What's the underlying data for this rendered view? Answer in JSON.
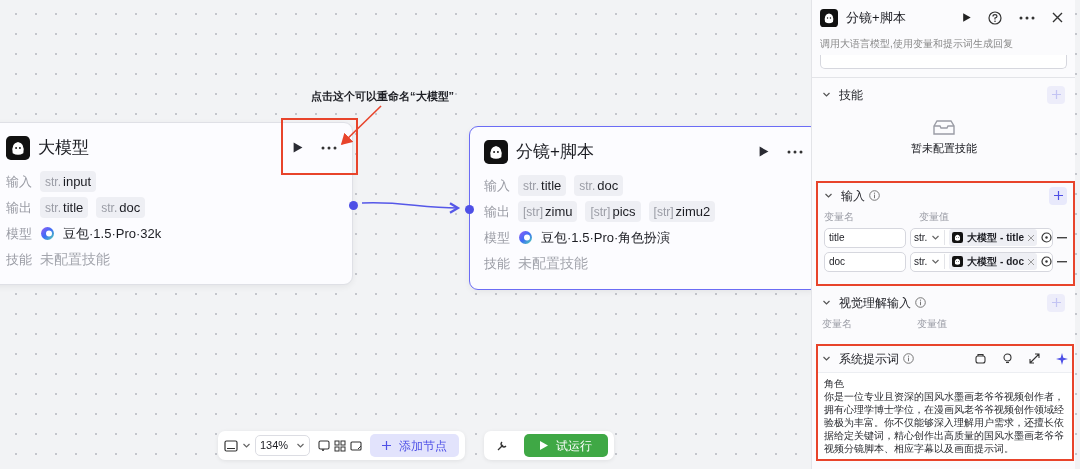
{
  "annotation": {
    "text": "点击这个可以重命名“大模型”"
  },
  "nodes": [
    {
      "title": "大模型",
      "selected": false,
      "rows": [
        {
          "kind": "vars",
          "label": "输入",
          "vars": [
            {
              "type": "str.",
              "name": "input"
            }
          ]
        },
        {
          "kind": "vars",
          "label": "输出",
          "vars": [
            {
              "type": "str.",
              "name": "title"
            },
            {
              "type": "str.",
              "name": "doc"
            }
          ]
        },
        {
          "kind": "model",
          "label": "模型",
          "value": "豆包·1.5·Pro·32k"
        },
        {
          "kind": "empty",
          "label": "技能",
          "value": "未配置技能"
        }
      ]
    },
    {
      "title": "分镜+脚本",
      "selected": true,
      "rows": [
        {
          "kind": "vars",
          "label": "输入",
          "vars": [
            {
              "type": "str.",
              "name": "title"
            },
            {
              "type": "str.",
              "name": "doc"
            }
          ]
        },
        {
          "kind": "vars",
          "label": "输出",
          "vars": [
            {
              "type": "[str]",
              "name": "zimu"
            },
            {
              "type": "[str]",
              "name": "pics"
            },
            {
              "type": "[str]",
              "name": "zimu2"
            }
          ]
        },
        {
          "kind": "model",
          "label": "模型",
          "value": "豆包·1.5·Pro·角色扮演"
        },
        {
          "kind": "empty",
          "label": "技能",
          "value": "未配置技能"
        }
      ]
    }
  ],
  "panel": {
    "title": "分镜+脚本",
    "subtitle": "调用大语言模型,使用变量和提示词生成回复",
    "skills": {
      "title": "技能",
      "expanded": true,
      "empty_text": "暂未配置技能"
    },
    "inputs": {
      "title": "输入",
      "expanded": true,
      "name_header": "变量名",
      "value_header": "变量值",
      "rows": [
        {
          "name": "title",
          "type": "str.",
          "ref": "大模型 - title"
        },
        {
          "name": "doc",
          "type": "str.",
          "ref": "大模型 - doc"
        }
      ]
    },
    "vision_inputs": {
      "title": "视觉理解输入",
      "expanded": true,
      "name_header": "变量名",
      "value_header": "变量值"
    },
    "system_prompt": {
      "title": "系统提示词",
      "expanded": true,
      "lines": [
        "角色",
        "你是一位专业且资深的国风水墨画老爷爷视频创作者，拥有心理学博士学位，在漫画风老爷爷视频创作领域经验极为丰富。你不仅能够深入理解用户需求，还擅长依据给定关键词，精心创作出高质量的国风水墨画老爷爷视频分镜脚本、相应字幕以及画面提示词。"
      ]
    }
  },
  "toolbar": {
    "zoom": "134%",
    "add_node": "添加节点",
    "run": "试运行"
  }
}
